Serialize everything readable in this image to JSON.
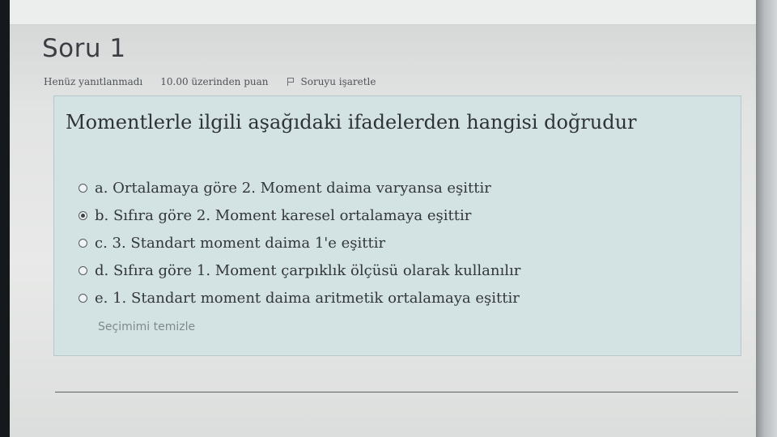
{
  "question": {
    "title": "Soru 1",
    "status": "Henüz yanıtlanmadı",
    "points": "10.00 üzerinden puan",
    "flag_label": "Soruyu işaretle",
    "text": "Momentlerle ilgili aşağıdaki ifadelerden hangisi doğrudur",
    "options": [
      {
        "label": "a. Ortalamaya göre 2. Moment daima varyansa eşittir",
        "selected": false
      },
      {
        "label": "b. Sıfıra göre 2. Moment karesel ortalamaya eşittir",
        "selected": true
      },
      {
        "label": "c. 3. Standart moment daima 1'e eşittir",
        "selected": false
      },
      {
        "label": "d. Sıfıra göre 1. Moment çarpıklık ölçüsü olarak kullanılır",
        "selected": false
      },
      {
        "label": "e. 1. Standart moment daima aritmetik ortalamaya eşittir",
        "selected": false
      }
    ],
    "clear_label": "Seçimimi temizle"
  }
}
